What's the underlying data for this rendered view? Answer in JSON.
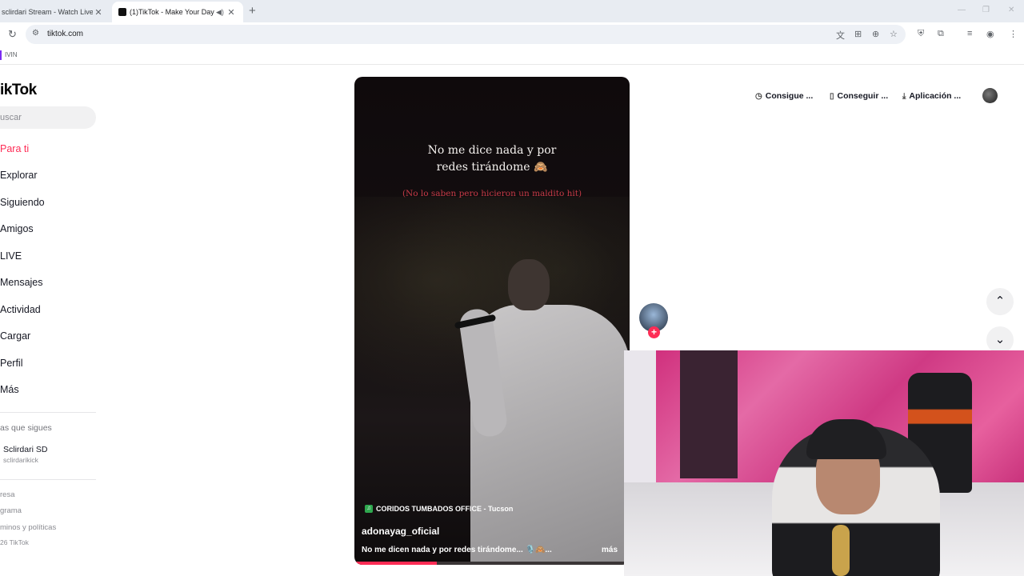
{
  "browser": {
    "tabs": [
      {
        "title": "sclirdari Stream - Watch Live on",
        "close": "✕"
      },
      {
        "title": "(1)TikTok - Make Your Day",
        "close": "✕"
      }
    ],
    "new_tab": "+",
    "url": "tiktok.com",
    "bookmark_label": "IVIN",
    "icons": [
      "reload-icon",
      "site-settings-icon",
      "translate-icon",
      "install-icon",
      "zoom-icon",
      "star-icon",
      "shield-icon",
      "extensions-icon",
      "media-icon",
      "profile-icon",
      "menu-icon"
    ]
  },
  "sidebar": {
    "logo": "ikTok",
    "search_placeholder": "uscar",
    "nav": [
      {
        "label": "Para ti"
      },
      {
        "label": "Explorar"
      },
      {
        "label": "Siguiendo"
      },
      {
        "label": "Amigos"
      },
      {
        "label": "LIVE"
      },
      {
        "label": "Mensajes"
      },
      {
        "label": "Actividad"
      },
      {
        "label": "Cargar"
      },
      {
        "label": "Perfil"
      },
      {
        "label": "Más"
      }
    ],
    "following_header": "as que sigues",
    "following_user": {
      "name": "Sclirdari SD",
      "handle": "sclirdarikick"
    },
    "footer": [
      "resa",
      "grama",
      "minos y políticas",
      "26 TikTok"
    ]
  },
  "video": {
    "caption_line1": "No me dice nada y por",
    "caption_line2": "redes tirándome 🙈",
    "caption_sub": "(No lo saben pero hicieron un maldito hit)",
    "music_icon": "♫",
    "music": "CORIDOS TUMBADOS OFFICE - Tucson",
    "author": "adonayag_oficial",
    "description": "No me dicen nada y por redes tirándome... 🎙️🙈...",
    "more": "más",
    "progress": 0.3,
    "accent": "#fe2c55"
  },
  "top_buttons": [
    {
      "icon": "◷",
      "label": "Consigue ..."
    },
    {
      "icon": "▯",
      "label": "Conseguir ..."
    },
    {
      "icon": "⤓",
      "label": "Aplicación ..."
    }
  ],
  "creator": {
    "follow": "+"
  },
  "nav_arrows": {
    "up": "⌃",
    "down": "⌄"
  }
}
